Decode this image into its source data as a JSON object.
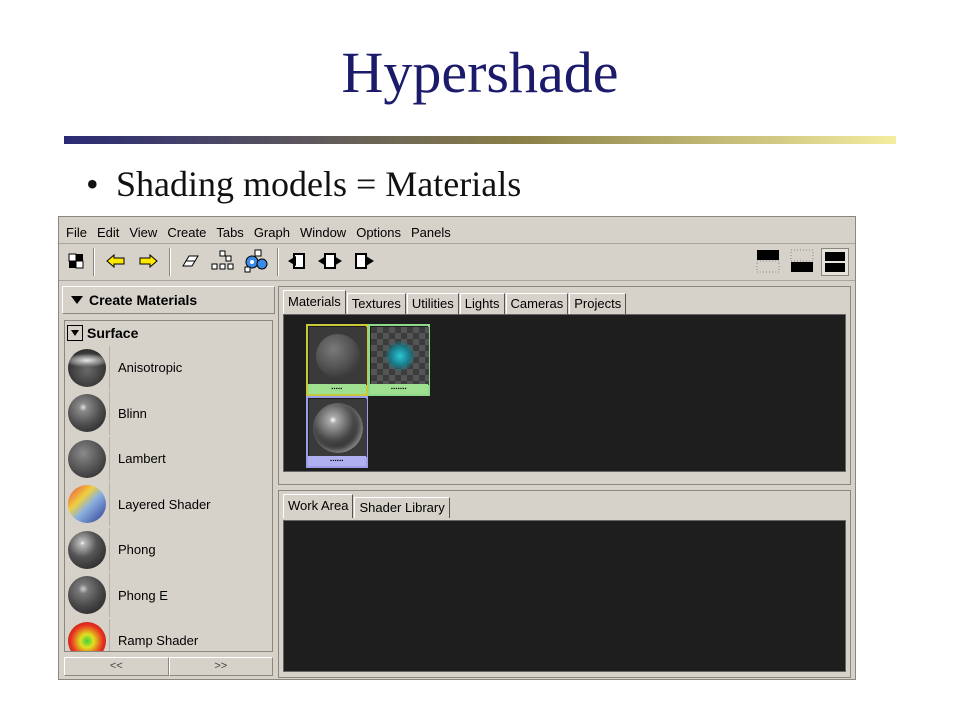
{
  "slide": {
    "title": "Hypershade",
    "bullet": "Shading models = Materials",
    "title_color": "#1b1a6b",
    "rule_colors": [
      "#2a2a74",
      "#e8e0a0"
    ]
  },
  "app": {
    "menu": [
      "File",
      "Edit",
      "View",
      "Create",
      "Tabs",
      "Graph",
      "Window",
      "Options",
      "Panels"
    ],
    "toolbar_icons": [
      "selection-mask-icon",
      "arrow-left-icon",
      "arrow-right-icon",
      "eraser-icon",
      "graph-materials-icon",
      "graph-network-icon",
      "input-connections-icon",
      "input-output-connections-icon",
      "output-connections-icon",
      "top-tabs-layout-icon",
      "bottom-tabs-layout-icon",
      "split-tabs-layout-icon"
    ],
    "left_panel": {
      "header": "Create Materials",
      "section": "Surface",
      "items": [
        {
          "label": "Anisotropic",
          "icon": "anisotropic-sphere-icon"
        },
        {
          "label": "Blinn",
          "icon": "blinn-sphere-icon"
        },
        {
          "label": "Lambert",
          "icon": "lambert-sphere-icon"
        },
        {
          "label": "Layered Shader",
          "icon": "layered-sphere-icon"
        },
        {
          "label": "Phong",
          "icon": "phong-sphere-icon"
        },
        {
          "label": "Phong E",
          "icon": "phong-e-sphere-icon"
        },
        {
          "label": "Ramp Shader",
          "icon": "ramp-sphere-icon"
        }
      ],
      "scroll_left": "<<",
      "scroll_right": ">>"
    },
    "top_tabs": [
      "Materials",
      "Textures",
      "Utilities",
      "Lights",
      "Cameras",
      "Projects"
    ],
    "top_active_tab": "Materials",
    "bottom_tabs": [
      "Work Area",
      "Shader Library"
    ],
    "bottom_active_tab": "Work Area",
    "swatches": [
      {
        "name": "lambert-material",
        "border": "#c8c83a",
        "label_bg": "#9ee08f"
      },
      {
        "name": "checker-texture",
        "border": "#8ed98a",
        "label_bg": "#9ee08f"
      },
      {
        "name": "phong-material",
        "border": "#9d9de8",
        "label_bg": "#b0b0f0"
      }
    ]
  }
}
